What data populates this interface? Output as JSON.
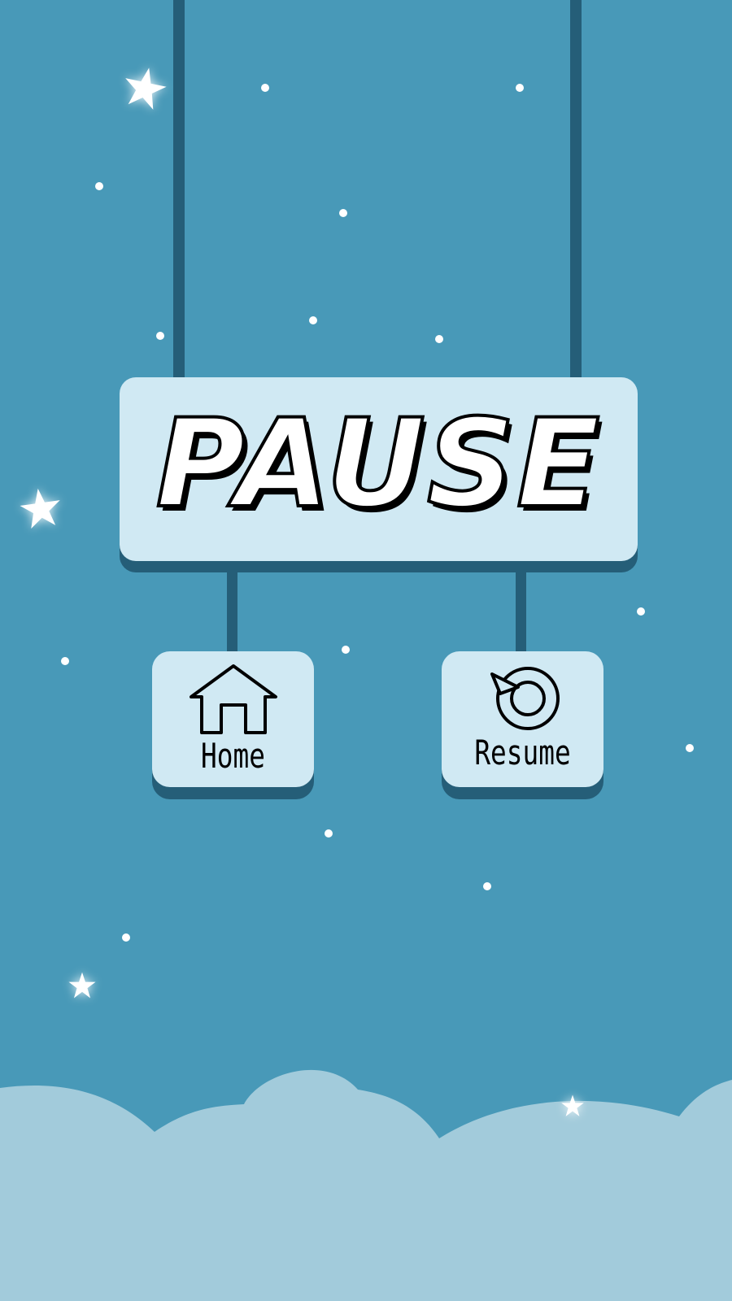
{
  "screen": {
    "title": "PAUSE",
    "background_color": "#4899b8",
    "rope_color": "#255e78",
    "panel_color": "#d0e9f3",
    "cloud_color": "#a2cbdb"
  },
  "buttons": {
    "home": {
      "label": "Home",
      "icon": "house-icon"
    },
    "resume": {
      "label": "Resume",
      "icon": "restart-icon"
    }
  }
}
